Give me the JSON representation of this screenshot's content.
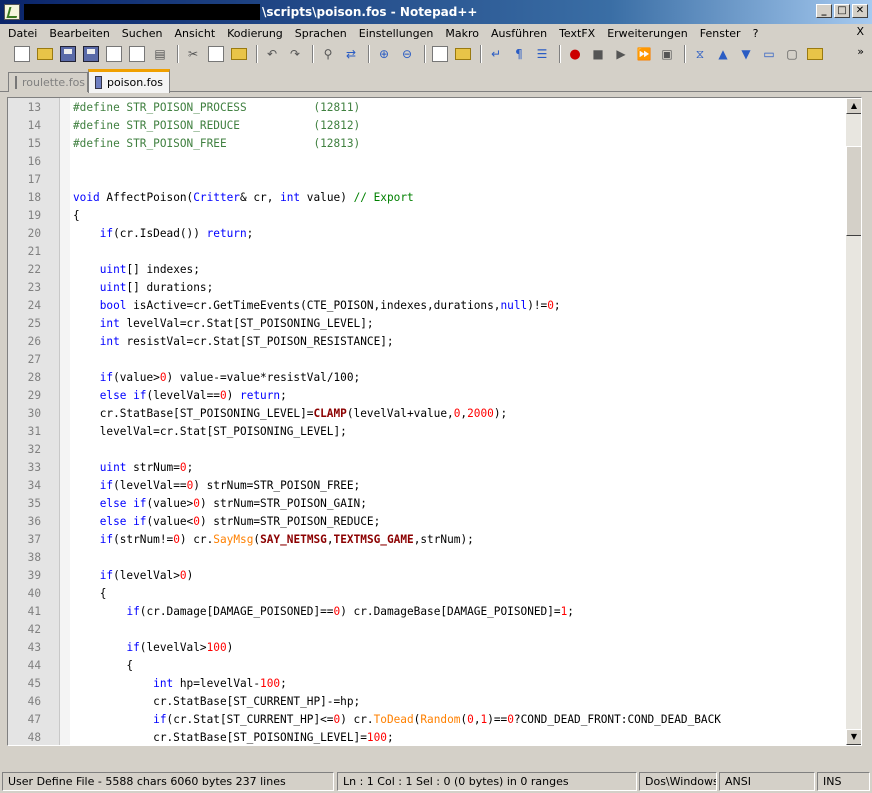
{
  "window": {
    "title": "\\scripts\\poison.fos - Notepad++",
    "buttons": {
      "minimize": "_",
      "maximize": "□",
      "close": "✕"
    }
  },
  "menu": {
    "items": [
      "Datei",
      "Bearbeiten",
      "Suchen",
      "Ansicht",
      "Kodierung",
      "Sprachen",
      "Einstellungen",
      "Makro",
      "Ausführen",
      "TextFX",
      "Erweiterungen",
      "Fenster",
      "?"
    ],
    "close_label": "X"
  },
  "toolbar": {
    "more_label": "»",
    "icons": [
      "new-file-icon",
      "open-file-icon",
      "save-icon",
      "save-all-icon",
      "close-icon",
      "close-all-icon",
      "print-icon",
      "cut-icon",
      "copy-icon",
      "paste-icon",
      "undo-icon",
      "redo-icon",
      "find-icon",
      "replace-icon",
      "zoom-in-icon",
      "zoom-out-icon",
      "sync-vertical-icon",
      "sync-horizontal-icon",
      "word-wrap-icon",
      "show-all-chars-icon",
      "indent-guide-icon",
      "macro-record-icon",
      "macro-stop-icon",
      "macro-play-icon",
      "macro-run-multiple-icon",
      "macro-save-icon",
      "collapse-icon",
      "arrow-up-icon",
      "arrow-down-icon",
      "monitor-icon",
      "console-icon",
      "plugin-icon"
    ]
  },
  "tabs": [
    {
      "label": "roulette.fos",
      "active": false
    },
    {
      "label": "poison.fos",
      "active": true
    }
  ],
  "editor": {
    "lines": [
      {
        "n": "13",
        "tokens": [
          [
            "pre",
            "#define STR_POISON_PROCESS          (12811)"
          ]
        ]
      },
      {
        "n": "14",
        "tokens": [
          [
            "pre",
            "#define STR_POISON_REDUCE           (12812)"
          ]
        ]
      },
      {
        "n": "15",
        "tokens": [
          [
            "pre",
            "#define STR_POISON_FREE             (12813)"
          ]
        ]
      },
      {
        "n": "16",
        "tokens": []
      },
      {
        "n": "17",
        "tokens": []
      },
      {
        "n": "18",
        "tokens": [
          [
            "kw",
            "void"
          ],
          [
            "t",
            " AffectPoison("
          ],
          [
            "kw",
            "Critter"
          ],
          [
            "t",
            "& cr, "
          ],
          [
            "kw",
            "int"
          ],
          [
            "t",
            " value) "
          ],
          [
            "cm",
            "// Export"
          ]
        ]
      },
      {
        "n": "19",
        "tokens": [
          [
            "t",
            "{"
          ]
        ]
      },
      {
        "n": "20",
        "tokens": [
          [
            "t",
            "    "
          ],
          [
            "kw",
            "if"
          ],
          [
            "t",
            "(cr.IsDead()) "
          ],
          [
            "kw",
            "return"
          ],
          [
            "t",
            ";"
          ]
        ]
      },
      {
        "n": "21",
        "tokens": []
      },
      {
        "n": "22",
        "tokens": [
          [
            "t",
            "    "
          ],
          [
            "kw",
            "uint"
          ],
          [
            "t",
            "[] indexes;"
          ]
        ]
      },
      {
        "n": "23",
        "tokens": [
          [
            "t",
            "    "
          ],
          [
            "kw",
            "uint"
          ],
          [
            "t",
            "[] durations;"
          ]
        ]
      },
      {
        "n": "24",
        "tokens": [
          [
            "t",
            "    "
          ],
          [
            "kw",
            "bool"
          ],
          [
            "t",
            " isActive=cr.GetTimeEvents(CTE_POISON,indexes,durations,"
          ],
          [
            "kw",
            "null"
          ],
          [
            "t",
            ")!="
          ],
          [
            "num",
            "0"
          ],
          [
            "t",
            ";"
          ]
        ]
      },
      {
        "n": "25",
        "tokens": [
          [
            "t",
            "    "
          ],
          [
            "kw",
            "int"
          ],
          [
            "t",
            " levelVal=cr.Stat[ST_POISONING_LEVEL];"
          ]
        ]
      },
      {
        "n": "26",
        "tokens": [
          [
            "t",
            "    "
          ],
          [
            "kw",
            "int"
          ],
          [
            "t",
            " resistVal=cr.Stat[ST_POISON_RESISTANCE];"
          ]
        ]
      },
      {
        "n": "27",
        "tokens": []
      },
      {
        "n": "28",
        "tokens": [
          [
            "t",
            "    "
          ],
          [
            "kw",
            "if"
          ],
          [
            "t",
            "(value>"
          ],
          [
            "num",
            "0"
          ],
          [
            "t",
            ") value-=value*resistVal/100;"
          ]
        ]
      },
      {
        "n": "29",
        "tokens": [
          [
            "t",
            "    "
          ],
          [
            "kw",
            "else if"
          ],
          [
            "t",
            "(levelVal=="
          ],
          [
            "num",
            "0"
          ],
          [
            "t",
            ") "
          ],
          [
            "kw",
            "return"
          ],
          [
            "t",
            ";"
          ]
        ]
      },
      {
        "n": "30",
        "tokens": [
          [
            "t",
            "    cr.StatBase[ST_POISONING_LEVEL]="
          ],
          [
            "red",
            "CLAMP"
          ],
          [
            "t",
            "(levelVal+value,"
          ],
          [
            "num",
            "0"
          ],
          [
            "t",
            ","
          ],
          [
            "num",
            "2000"
          ],
          [
            "t",
            ");"
          ]
        ]
      },
      {
        "n": "31",
        "tokens": [
          [
            "t",
            "    levelVal=cr.Stat[ST_POISONING_LEVEL];"
          ]
        ]
      },
      {
        "n": "32",
        "tokens": []
      },
      {
        "n": "33",
        "tokens": [
          [
            "t",
            "    "
          ],
          [
            "kw",
            "uint"
          ],
          [
            "t",
            " strNum="
          ],
          [
            "num",
            "0"
          ],
          [
            "t",
            ";"
          ]
        ]
      },
      {
        "n": "34",
        "tokens": [
          [
            "t",
            "    "
          ],
          [
            "kw",
            "if"
          ],
          [
            "t",
            "(levelVal=="
          ],
          [
            "num",
            "0"
          ],
          [
            "t",
            ") strNum=STR_POISON_FREE;"
          ]
        ]
      },
      {
        "n": "35",
        "tokens": [
          [
            "t",
            "    "
          ],
          [
            "kw",
            "else if"
          ],
          [
            "t",
            "(value>"
          ],
          [
            "num",
            "0"
          ],
          [
            "t",
            ") strNum=STR_POISON_GAIN;"
          ]
        ]
      },
      {
        "n": "36",
        "tokens": [
          [
            "t",
            "    "
          ],
          [
            "kw",
            "else if"
          ],
          [
            "t",
            "(value<"
          ],
          [
            "num",
            "0"
          ],
          [
            "t",
            ") strNum=STR_POISON_REDUCE;"
          ]
        ]
      },
      {
        "n": "37",
        "tokens": [
          [
            "t",
            "    "
          ],
          [
            "kw",
            "if"
          ],
          [
            "t",
            "(strNum!="
          ],
          [
            "num",
            "0"
          ],
          [
            "t",
            ") cr."
          ],
          [
            "orn",
            "SayMsg"
          ],
          [
            "t",
            "("
          ],
          [
            "red",
            "SAY_NETMSG"
          ],
          [
            "t",
            ","
          ],
          [
            "red",
            "TEXTMSG_GAME"
          ],
          [
            "t",
            ",strNum);"
          ]
        ]
      },
      {
        "n": "38",
        "tokens": []
      },
      {
        "n": "39",
        "tokens": [
          [
            "t",
            "    "
          ],
          [
            "kw",
            "if"
          ],
          [
            "t",
            "(levelVal>"
          ],
          [
            "num",
            "0"
          ],
          [
            "t",
            ")"
          ]
        ]
      },
      {
        "n": "40",
        "tokens": [
          [
            "t",
            "    {"
          ]
        ]
      },
      {
        "n": "41",
        "tokens": [
          [
            "t",
            "        "
          ],
          [
            "kw",
            "if"
          ],
          [
            "t",
            "(cr.Damage[DAMAGE_POISONED]=="
          ],
          [
            "num",
            "0"
          ],
          [
            "t",
            ") cr.DamageBase[DAMAGE_POISONED]="
          ],
          [
            "num",
            "1"
          ],
          [
            "t",
            ";"
          ]
        ]
      },
      {
        "n": "42",
        "tokens": []
      },
      {
        "n": "43",
        "tokens": [
          [
            "t",
            "        "
          ],
          [
            "kw",
            "if"
          ],
          [
            "t",
            "(levelVal>"
          ],
          [
            "num",
            "100"
          ],
          [
            "t",
            ")"
          ]
        ]
      },
      {
        "n": "44",
        "tokens": [
          [
            "t",
            "        {"
          ]
        ]
      },
      {
        "n": "45",
        "tokens": [
          [
            "t",
            "            "
          ],
          [
            "kw",
            "int"
          ],
          [
            "t",
            " hp=levelVal-"
          ],
          [
            "num",
            "100"
          ],
          [
            "t",
            ";"
          ]
        ]
      },
      {
        "n": "46",
        "tokens": [
          [
            "t",
            "            cr.StatBase[ST_CURRENT_HP]-=hp;"
          ]
        ]
      },
      {
        "n": "47",
        "tokens": [
          [
            "t",
            "            "
          ],
          [
            "kw",
            "if"
          ],
          [
            "t",
            "(cr.Stat[ST_CURRENT_HP]<="
          ],
          [
            "num",
            "0"
          ],
          [
            "t",
            ") cr."
          ],
          [
            "orn",
            "ToDead"
          ],
          [
            "t",
            "("
          ],
          [
            "orn",
            "Random"
          ],
          [
            "t",
            "("
          ],
          [
            "num",
            "0"
          ],
          [
            "t",
            ","
          ],
          [
            "num",
            "1"
          ],
          [
            "t",
            ")=="
          ],
          [
            "num",
            "0"
          ],
          [
            "t",
            "?COND_DEAD_FRONT:COND_DEAD_BACK"
          ]
        ]
      },
      {
        "n": "48",
        "tokens": [
          [
            "t",
            "            cr.StatBase[ST_POISONING_LEVEL]="
          ],
          [
            "num",
            "100"
          ],
          [
            "t",
            ";"
          ]
        ]
      }
    ]
  },
  "scrollbar": {
    "up": "▲",
    "down": "▼"
  },
  "status": {
    "file_type": "User Define File - 5588 chars  6060 bytes  237 lines",
    "position": "Ln : 1    Col : 1    Sel : 0 (0 bytes) in 0 ranges",
    "eol": "Dos\\Windows",
    "encoding": "ANSI",
    "mode": "INS"
  }
}
